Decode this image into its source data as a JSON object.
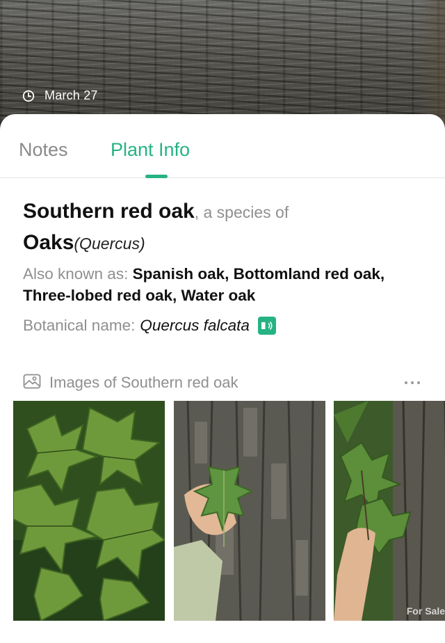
{
  "header": {
    "date": "March 27",
    "clock_icon": "clock-icon"
  },
  "tabs": [
    {
      "label": "Notes",
      "active": false
    },
    {
      "label": "Plant Info",
      "active": true
    }
  ],
  "plant": {
    "common_name": "Southern red oak",
    "species_of_text": ", a species of",
    "genus_common": "Oaks",
    "genus_scientific": "(Quercus)",
    "aka_label": "Also known as:",
    "aka_names": "Spanish oak, Bottomland red oak, Three-lobed red oak, Water oak",
    "botanical_label": "Botanical name:",
    "botanical_name": "Quercus falcata"
  },
  "images_section": {
    "title": "Images of Southern red oak",
    "icon": "image-gallery-icon",
    "more_icon": "more-dots-icon",
    "items": [
      {
        "name": "oak-leaves-photo"
      },
      {
        "name": "hand-leaf-bark-photo"
      },
      {
        "name": "hand-branch-trunk-photo"
      }
    ],
    "watermark": "For Sale"
  },
  "colors": {
    "accent": "#25b383",
    "muted_text": "#8f8f8f",
    "primary_text": "#111111"
  }
}
